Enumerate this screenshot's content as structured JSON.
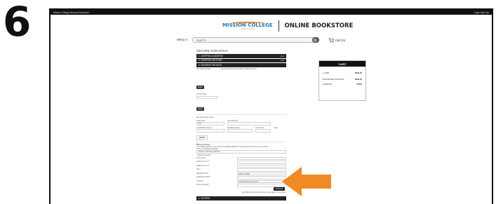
{
  "step_number": "6",
  "topbar": {
    "left_text": "Mission College Services Bookstore",
    "right_text": "Login Help Fax"
  },
  "brand": {
    "logo_text": "MISSION COLLEGE",
    "logo_sub": "SANTA CLARA",
    "store_name": "ONLINE BOOKSTORE"
  },
  "nav": {
    "menu_label": "Menu ∨",
    "search_placeholder": "Search",
    "cart_label": "Cart (0)"
  },
  "checkout": {
    "title": "SECURE CHECKOUT",
    "steps": [
      {
        "label": "1. SHIPPING ADDRESS",
        "action": "Edit"
      },
      {
        "label": "2. SHIPPING METHOD",
        "action": "Edit"
      },
      {
        "label": "3. PAYMENT METHOD",
        "action": ""
      }
    ],
    "payment_note_left": "Gift Card Number",
    "payment_note_right": "Security PIN (if Card Applies Case Sensitive)",
    "apply_label": "Apply",
    "promo_label": "Promo Code",
    "apply2_label": "Apply",
    "card_label": "Pay with Credit Card",
    "card_type_label": "Card Type",
    "card_type_value": "Visa",
    "card_number_label": "Card Number",
    "name_label": "Cardholder's Name",
    "exp_label": "Expiration Date",
    "cvv_label": "CVV Code",
    "save_label": "Save",
    "paypal_label": "PayPal",
    "billing_title": "Billing Address",
    "billing_note": "Your billing address must match the billing address of the payment method you are using.",
    "same_label": "Same as shipping address",
    "select_label": "Select a Previous Address",
    "required_note": "* Required Fields",
    "fields": [
      "First Name *",
      "Address Line 1 *",
      "Address Line 2",
      "City *",
      "State/Province *",
      "Zip/Postal Code *",
      "Country *",
      "Phone Number *"
    ],
    "state_value": "Select a State",
    "country_value": "United States of America",
    "continue_label": "Continue",
    "terms_note": "By clicking the Continue button, you agree to our terms",
    "review_label": "4. REVIEW"
  },
  "cart": {
    "title": "CART",
    "lines": [
      {
        "label": "1 ITEM",
        "value": "$999.95"
      },
      {
        "label": "ESTIMATED SUBTOTAL",
        "value": "$999.95"
      },
      {
        "label": "SHIPPING",
        "value": "FREE"
      }
    ]
  },
  "colors": {
    "arrow": "#f08a24",
    "brand_blue": "#2a73b8",
    "brand_orange": "#e08a1e",
    "bar": "#222222"
  }
}
